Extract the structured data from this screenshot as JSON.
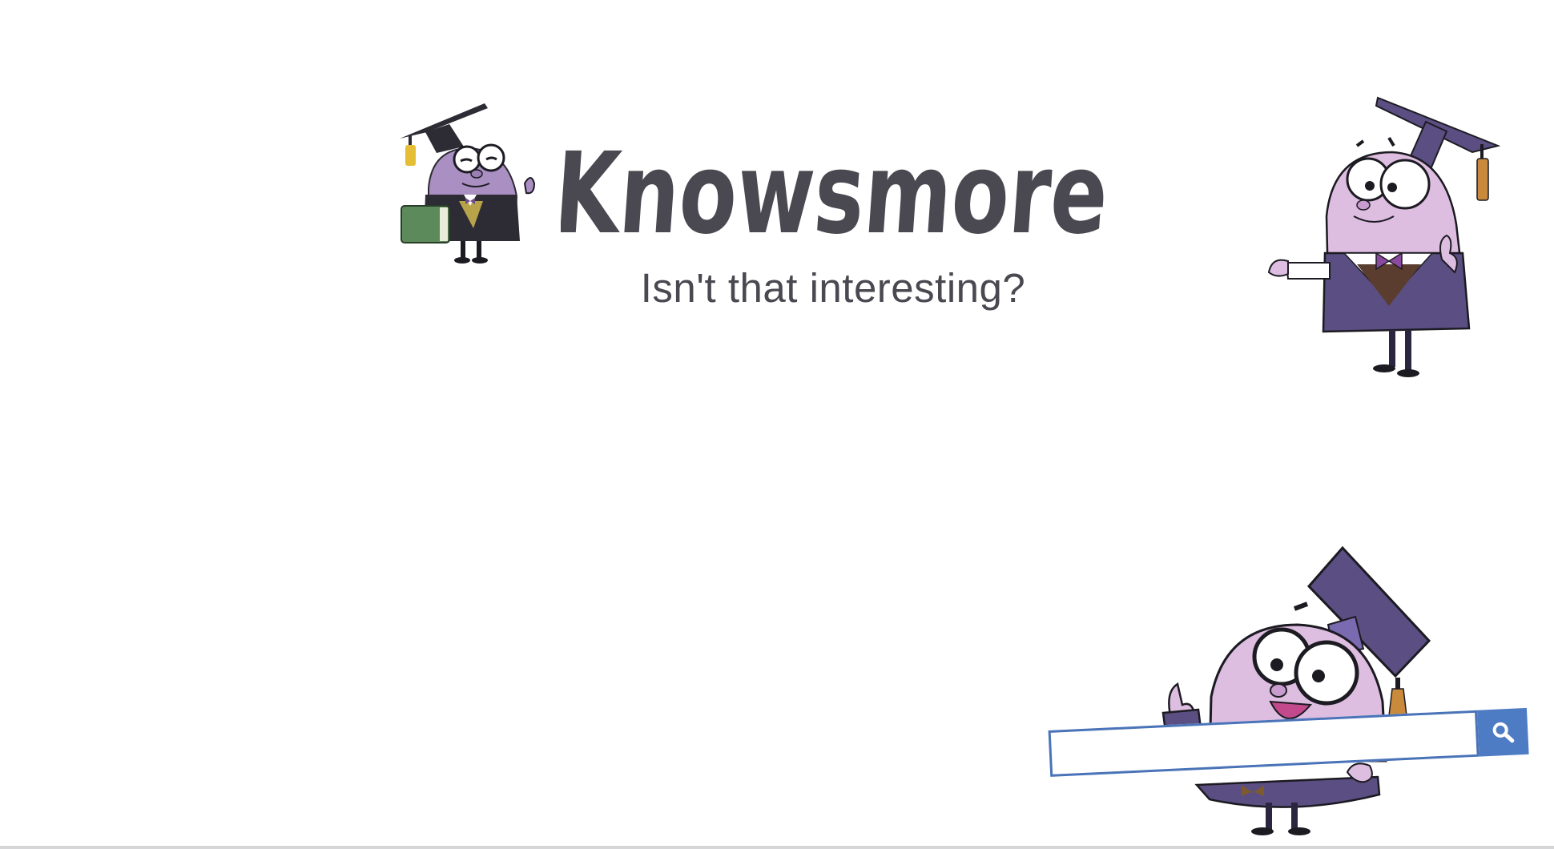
{
  "brand": {
    "name": "Knowsmore",
    "tagline": "Isn't that interesting?"
  },
  "search": {
    "placeholder": "",
    "value": "",
    "button_icon": "search-icon"
  },
  "colors": {
    "logo_text": "#4a4951",
    "mascot_body": "#ddbde0",
    "mascot_gown": "#5b4e82",
    "search_border": "#4a73b8",
    "search_button": "#4e7cc4"
  },
  "mascots": [
    {
      "name": "mascot-with-book",
      "pose": "holding book"
    },
    {
      "name": "mascot-pointing",
      "pose": "pointing"
    },
    {
      "name": "mascot-holding-search",
      "pose": "holding search bar"
    }
  ]
}
